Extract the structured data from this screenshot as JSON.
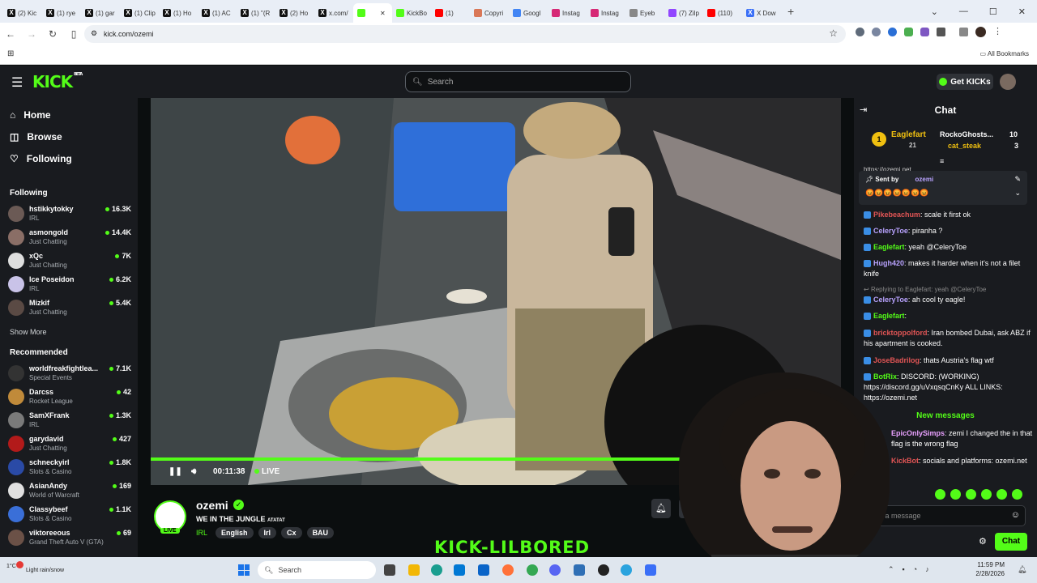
{
  "browser": {
    "tabs": [
      {
        "label": "(2) Kic",
        "icon": "x-icon",
        "color": "#111111"
      },
      {
        "label": "(1) rye",
        "icon": "x-icon",
        "color": "#111111"
      },
      {
        "label": "(1) gar",
        "icon": "x-icon",
        "color": "#111111"
      },
      {
        "label": "(1) Clip",
        "icon": "x-icon",
        "color": "#111111"
      },
      {
        "label": "(1) Ho",
        "icon": "x-icon",
        "color": "#111111"
      },
      {
        "label": "(1) AC",
        "icon": "x-icon",
        "color": "#111111"
      },
      {
        "label": "(1) \"(R",
        "icon": "x-icon",
        "color": "#111111"
      },
      {
        "label": "(2) Ho",
        "icon": "x-icon",
        "color": "#111111"
      },
      {
        "label": "x.com/",
        "icon": "x-icon",
        "color": "#111111"
      },
      {
        "label": "",
        "icon": "kick-icon",
        "color": "#53fc18",
        "active": true
      },
      {
        "label": "KickBo",
        "icon": "kickbot-icon",
        "color": "#53fc18"
      },
      {
        "label": "(1)",
        "icon": "youtube-icon",
        "color": "#ff0000"
      },
      {
        "label": "Copyri",
        "icon": "claude-icon",
        "color": "#d97757"
      },
      {
        "label": "Googl",
        "icon": "gemini-icon",
        "color": "#4285f4"
      },
      {
        "label": "Instag",
        "icon": "instagram-icon",
        "color": "#d62976"
      },
      {
        "label": "Instag",
        "icon": "instagram-icon",
        "color": "#d62976"
      },
      {
        "label": "Eyeb",
        "icon": "eye-icon",
        "color": "#888888"
      },
      {
        "label": "(7) Zilp",
        "icon": "twitch-icon",
        "color": "#9146ff"
      },
      {
        "label": "(110)",
        "icon": "youtube-icon",
        "color": "#ff0000"
      },
      {
        "label": "X Dow",
        "icon": "x-icon",
        "color": "#3a6ff7"
      }
    ],
    "url": "kick.com/ozemi",
    "all_bookmarks": "All Bookmarks"
  },
  "header": {
    "logo": "KICK",
    "logo_badge": "BETA",
    "search_placeholder": "Search",
    "get_kicks": "Get KICKs"
  },
  "sidebar": {
    "nav": [
      {
        "label": "Home",
        "icon": "home-icon"
      },
      {
        "label": "Browse",
        "icon": "browse-icon"
      },
      {
        "label": "Following",
        "icon": "heart-icon"
      }
    ],
    "following_title": "Following",
    "following": [
      {
        "name": "hstikkytokky",
        "category": "IRL",
        "viewers": "16.3K",
        "color": "#6b5a55"
      },
      {
        "name": "asmongold",
        "category": "Just Chatting",
        "viewers": "14.4K",
        "color": "#8a6e66"
      },
      {
        "name": "xQc",
        "category": "Just Chatting",
        "viewers": "7K",
        "color": "#dedede"
      },
      {
        "name": "Ice Poseidon",
        "category": "IRL",
        "viewers": "6.2K",
        "color": "#c9c3e8"
      },
      {
        "name": "Mizkif",
        "category": "Just Chatting",
        "viewers": "5.4K",
        "color": "#5a4a44"
      }
    ],
    "show_more": "Show More",
    "recommended_title": "Recommended",
    "recommended": [
      {
        "name": "worldfreakfightlea...",
        "category": "Special Events",
        "viewers": "7.1K",
        "color": "#333333"
      },
      {
        "name": "Darcss",
        "category": "Rocket League",
        "viewers": "42",
        "color": "#c08a3a"
      },
      {
        "name": "SamXFrank",
        "category": "IRL",
        "viewers": "1.3K",
        "color": "#7a7a7a"
      },
      {
        "name": "garydavid",
        "category": "Just Chatting",
        "viewers": "427",
        "color": "#b21a1a"
      },
      {
        "name": "schneckyirl",
        "category": "Slots & Casino",
        "viewers": "1.8K",
        "color": "#2a4aa6"
      },
      {
        "name": "AsianAndy",
        "category": "World of Warcraft",
        "viewers": "169",
        "color": "#e0e0e0"
      },
      {
        "name": "Classybeef",
        "category": "Slots & Casino",
        "viewers": "1.1K",
        "color": "#3a6fd8"
      },
      {
        "name": "viktoreeous",
        "category": "Grand Theft Auto V (GTA)",
        "viewers": "69",
        "color": "#6b5147"
      }
    ]
  },
  "player": {
    "time": "00:11:38",
    "live": "LIVE",
    "progress": 0.9
  },
  "stream": {
    "channel": "ozemi",
    "live_badge": "LIVE",
    "title": "WE IN THE JUNGLE",
    "title_suffix": "ATATAT",
    "category": "IRL",
    "tags": [
      "English",
      "Irl",
      "Cx",
      "BAU"
    ],
    "overlay_text": "KICK-LILBORED"
  },
  "chat": {
    "title": "Chat",
    "leaderboard": [
      {
        "rank": "1",
        "name": "Eaglefart",
        "count": "21"
      },
      {
        "name": "RockoGhosts...",
        "count": "10"
      },
      {
        "name": "cat_steak",
        "count": "3"
      }
    ],
    "cut_link": "https://ozemi.net",
    "pinned": {
      "sent_by": "Sent by",
      "user": "ozemi",
      "emotes": "😡😡😡😡😡😡😡"
    },
    "messages": [
      {
        "user": "Pikebeachum",
        "color": "#e25555",
        "text": ": scale it first ok"
      },
      {
        "user": "CeleryToe",
        "color": "#b9a3ff",
        "text": ": piranha ?"
      },
      {
        "user": "Eaglefart",
        "color": "#53fc18",
        "text": ": yeah @CeleryToe"
      },
      {
        "user": "Hugh420",
        "color": "#b9a3ff",
        "text": ": makes it harder when it's not a filet knife"
      },
      {
        "reply": "Replying to Eaglefart: yeah @CeleryToe"
      },
      {
        "user": "CeleryToe",
        "color": "#b9a3ff",
        "text": ": ah cool ty eagle!"
      },
      {
        "user": "Eaglefart",
        "color": "#53fc18",
        "text": ":"
      },
      {
        "user": "bricktoppolford",
        "color": "#e25555",
        "text": ": Iran bombed Dubai, ask ABZ if his apartment is cooked."
      },
      {
        "user": "JoseBadrilog",
        "color": "#e25555",
        "text": ": thats Austria's flag wtf"
      },
      {
        "user": "BotRix",
        "color": "#53fc18",
        "text": ": DISCORD: (WORKING) https://discord.gg/uVxqsqCnKy ALL LINKS: https://ozemi.net"
      }
    ],
    "new_messages": "New messages",
    "after": [
      {
        "user": "EpicOnlySimps",
        "color": "#e9a1ff",
        "text": ": zemi I changed the in that flag is the wrong flag"
      },
      {
        "user": "KickBot",
        "color": "#e25555",
        "text": ": socials and platforms: ozemi.net"
      }
    ],
    "input_placeholder": "Send a message",
    "send": "Chat"
  },
  "taskbar": {
    "weather_temp": "1°C",
    "weather_text": "Light rain/snow",
    "search": "Search",
    "time": "11:59 PM",
    "date": "2/28/2026"
  }
}
